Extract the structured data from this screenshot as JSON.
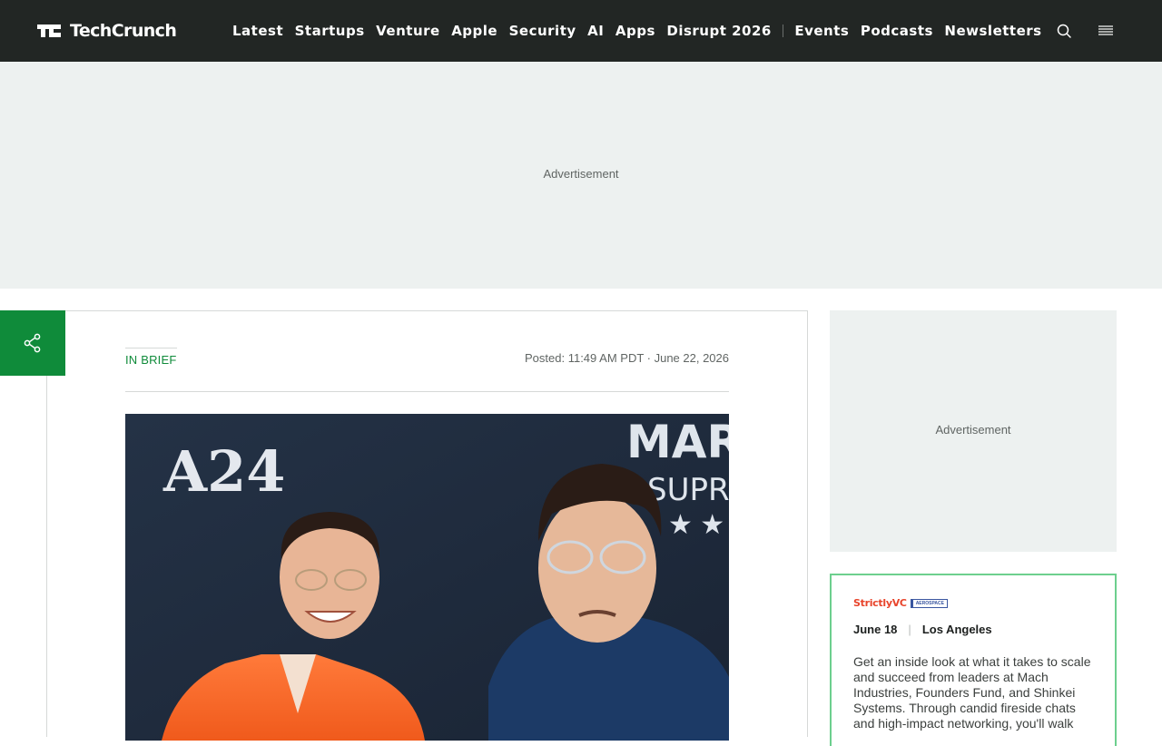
{
  "header": {
    "logo_text": "TechCrunch",
    "nav": [
      "Latest",
      "Startups",
      "Venture",
      "Apple",
      "Security",
      "AI",
      "Apps",
      "Disrupt 2026"
    ],
    "nav_secondary": [
      "Events",
      "Podcasts",
      "Newsletters"
    ],
    "icons": {
      "search": "search-icon",
      "menu": "hamburger-menu-icon"
    }
  },
  "top_ad": {
    "label": "Advertisement"
  },
  "share": {
    "icon": "share-icon"
  },
  "article": {
    "kicker": "IN BRIEF",
    "posted": "Posted: 11:49 AM PDT · June 22, 2026",
    "hero": {
      "backdrop_text": [
        "A24",
        "MAR",
        "SUPR"
      ]
    }
  },
  "sidebar": {
    "ad_label": "Advertisement",
    "event": {
      "brand": "StrictlyVC",
      "partner": "AEROSPACE",
      "date": "June 18",
      "location": "Los Angeles",
      "description": "Get an inside look at what it takes to scale and succeed from leaders at Mach Industries, Founders Fund, and Shinkei Systems. Through candid fireside chats and high-impact networking, you'll walk"
    }
  },
  "colors": {
    "header_bg": "#222624",
    "accent_green": "#0f8b3a",
    "ad_bg": "#edf1f0",
    "event_border": "#6dcf8e",
    "brand_red": "#e8442b"
  }
}
